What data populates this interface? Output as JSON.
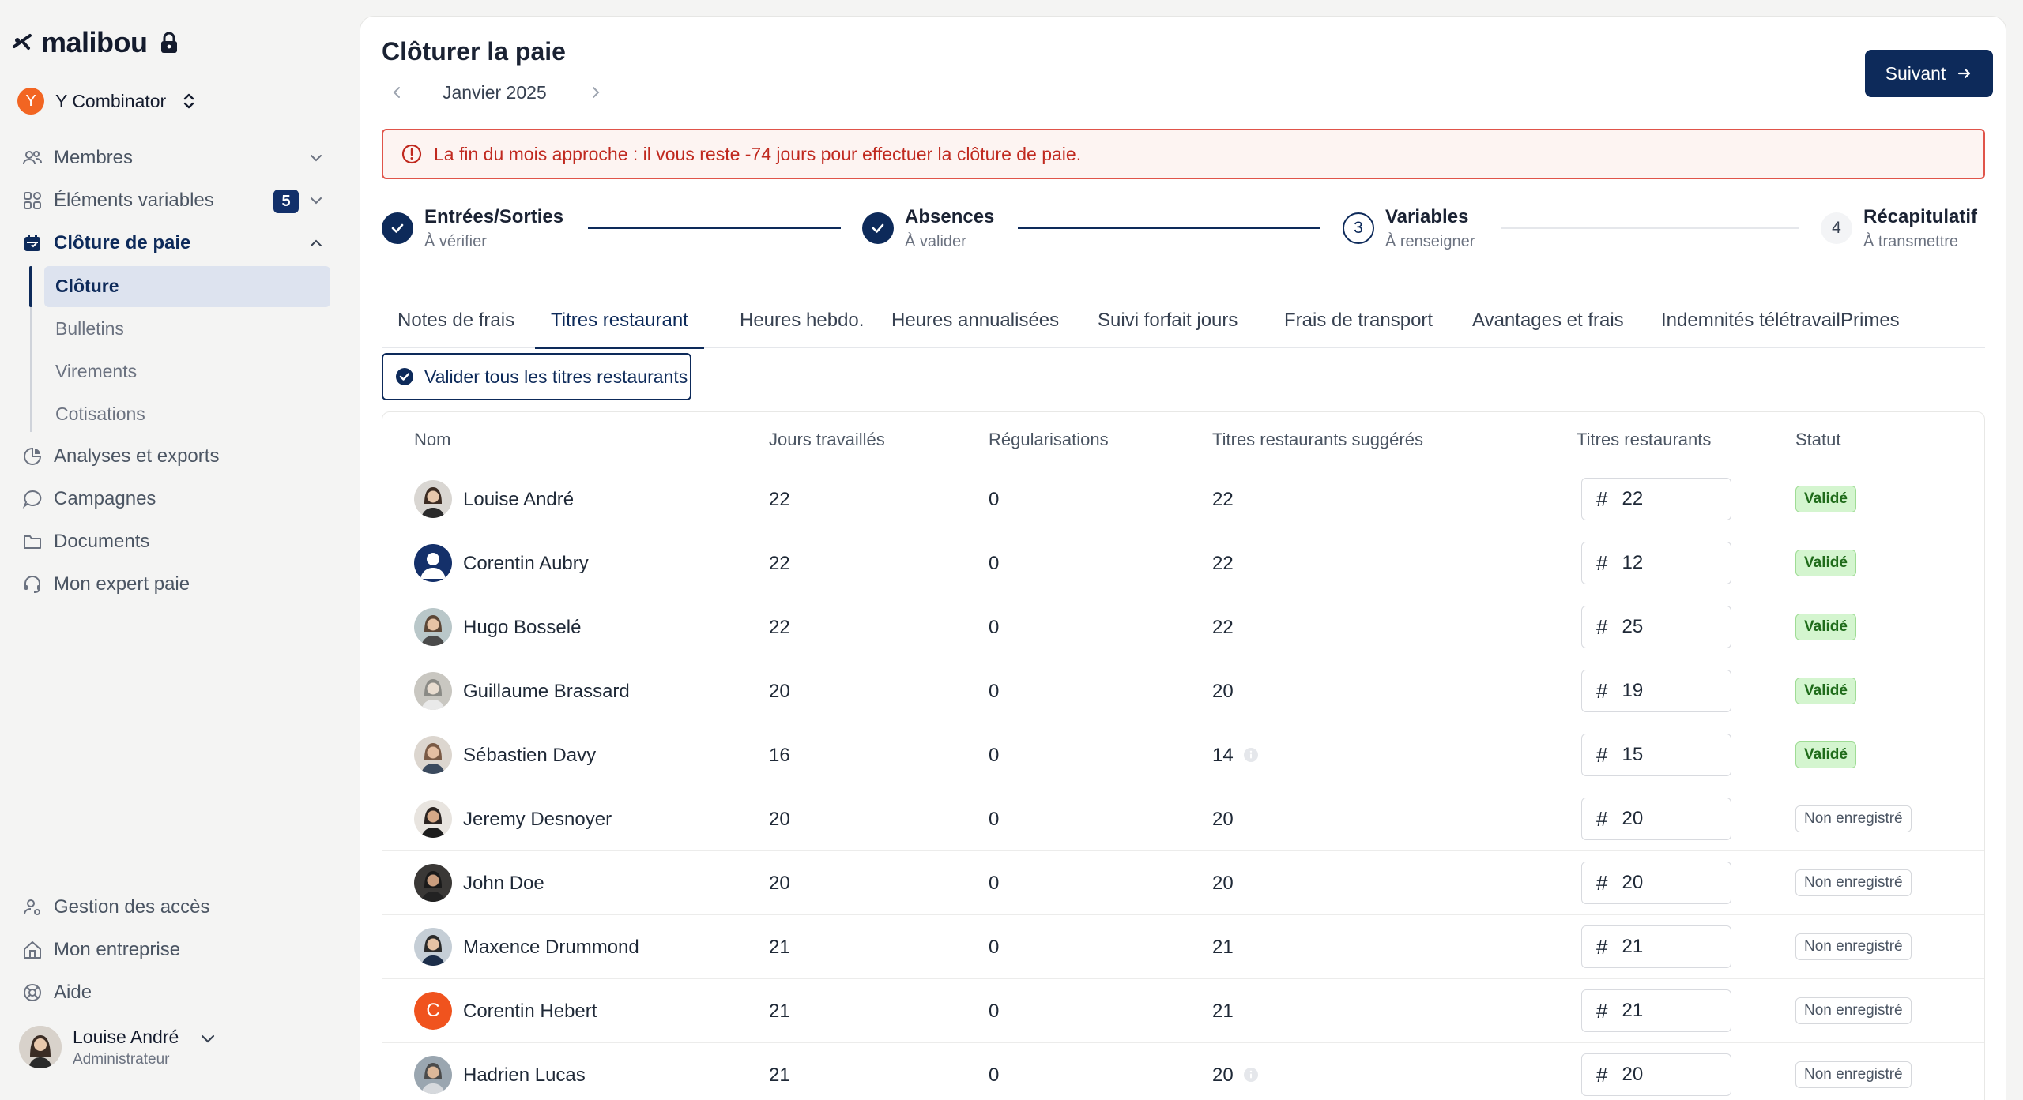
{
  "app": {
    "logo_text": "malibou",
    "company": {
      "initial": "Y",
      "name": "Y Combinator"
    }
  },
  "sidebar": {
    "nav": [
      {
        "label": "Membres",
        "icon": "users-icon"
      },
      {
        "label": "Éléments variables",
        "icon": "grid-icon",
        "badge": "5"
      },
      {
        "label": "Clôture de paie",
        "icon": "calendar-icon"
      }
    ],
    "sub": [
      {
        "label": "Clôture"
      },
      {
        "label": "Bulletins"
      },
      {
        "label": "Virements"
      },
      {
        "label": "Cotisations"
      }
    ],
    "nav2": [
      {
        "label": "Analyses et exports",
        "icon": "chart-icon"
      },
      {
        "label": "Campagnes",
        "icon": "chat-icon"
      },
      {
        "label": "Documents",
        "icon": "folder-icon"
      },
      {
        "label": "Mon expert paie",
        "icon": "headset-icon"
      }
    ],
    "bottom": [
      {
        "label": "Gestion des accès",
        "icon": "user-key-icon"
      },
      {
        "label": "Mon entreprise",
        "icon": "building-icon"
      },
      {
        "label": "Aide",
        "icon": "help-icon"
      }
    ],
    "user": {
      "name": "Louise André",
      "role": "Administrateur"
    }
  },
  "header": {
    "title": "Clôturer la paie",
    "month": "Janvier 2025",
    "next_label": "Suivant"
  },
  "alert": {
    "text": "La fin du mois approche : il vous reste -74 jours pour effectuer la clôture de paie."
  },
  "steps": [
    {
      "title": "Entrées/Sorties",
      "sub": "À vérifier",
      "state": "done"
    },
    {
      "title": "Absences",
      "sub": "À valider",
      "state": "done"
    },
    {
      "number": "3",
      "title": "Variables",
      "sub": "À renseigner",
      "state": "current"
    },
    {
      "number": "4",
      "title": "Récapitulatif",
      "sub": "À transmettre",
      "state": "todo"
    }
  ],
  "tabs": [
    "Notes de frais",
    "Titres restaurant",
    "Heures hebdo.",
    "Heures annualisées",
    "Suivi forfait jours",
    "Frais de transport",
    "Avantages et frais",
    "Indemnités télétravail",
    "Primes"
  ],
  "active_tab": 1,
  "validate_all_label": "Valider tous les titres restaurants",
  "table": {
    "headers": [
      "Nom",
      "Jours travaillés",
      "Régularisations",
      "Titres restaurants suggérés",
      "Titres restaurants",
      "Statut"
    ],
    "input_prefix": "#",
    "rows": [
      {
        "name": "Louise André",
        "days": "22",
        "reg": "0",
        "suggested": "22",
        "info": false,
        "titres": "22",
        "status": "Validé",
        "ok": true
      },
      {
        "name": "Corentin Aubry",
        "days": "22",
        "reg": "0",
        "suggested": "22",
        "info": false,
        "titres": "12",
        "status": "Validé",
        "ok": true
      },
      {
        "name": "Hugo Bosselé",
        "days": "22",
        "reg": "0",
        "suggested": "22",
        "info": false,
        "titres": "25",
        "status": "Validé",
        "ok": true
      },
      {
        "name": "Guillaume Brassard",
        "days": "20",
        "reg": "0",
        "suggested": "20",
        "info": false,
        "titres": "19",
        "status": "Validé",
        "ok": true
      },
      {
        "name": "Sébastien Davy",
        "days": "16",
        "reg": "0",
        "suggested": "14",
        "info": true,
        "titres": "15",
        "status": "Validé",
        "ok": true
      },
      {
        "name": "Jeremy Desnoyer",
        "days": "20",
        "reg": "0",
        "suggested": "20",
        "info": false,
        "titres": "20",
        "status": "Non enregistré",
        "ok": false
      },
      {
        "name": "John Doe",
        "days": "20",
        "reg": "0",
        "suggested": "20",
        "info": false,
        "titres": "20",
        "status": "Non enregistré",
        "ok": false
      },
      {
        "name": "Maxence Drummond",
        "days": "21",
        "reg": "0",
        "suggested": "21",
        "info": false,
        "titres": "21",
        "status": "Non enregistré",
        "ok": false
      },
      {
        "name": "Corentin Hebert",
        "days": "21",
        "reg": "0",
        "suggested": "21",
        "info": false,
        "titres": "21",
        "status": "Non enregistré",
        "ok": false,
        "initial": "C"
      },
      {
        "name": "Hadrien Lucas",
        "days": "21",
        "reg": "0",
        "suggested": "20",
        "info": true,
        "titres": "20",
        "status": "Non enregistré",
        "ok": false
      }
    ]
  }
}
